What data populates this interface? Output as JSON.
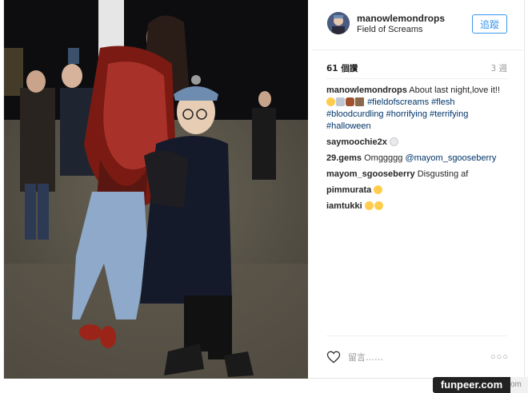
{
  "post": {
    "owner": {
      "username": "manowlemondrops",
      "location": "Field of Screams",
      "follow_label": "追蹤"
    },
    "stats": {
      "likes": "61 個讚",
      "age": "3 週"
    },
    "caption": {
      "username": "manowlemondrops",
      "text": "About last night,love it!!",
      "hashtags": [
        "#fieldofscreams",
        "#flesh",
        "#bloodcurdling",
        "#horrifying",
        "#terrifying",
        "#halloween"
      ]
    },
    "comments": [
      {
        "username": "saymoochie2x",
        "text": ""
      },
      {
        "username": "29.gems",
        "text": "Omggggg",
        "mention": "@mayom_sgooseberry"
      },
      {
        "username": "mayom_sgooseberry",
        "text": "Disgusting af"
      },
      {
        "username": "pimmurata",
        "text": ""
      },
      {
        "username": "iamtukki",
        "text": ""
      }
    ],
    "add_comment_placeholder": "留言……",
    "more_label": "○○○"
  },
  "watermark": {
    "text": "funpeer.com",
    "tail": "om"
  },
  "icons": [
    "heart-icon",
    "more-options-icon",
    "avatar"
  ],
  "colors": {
    "link": "#003569",
    "follow": "#3897f0",
    "muted": "#999999",
    "text": "#262626"
  }
}
